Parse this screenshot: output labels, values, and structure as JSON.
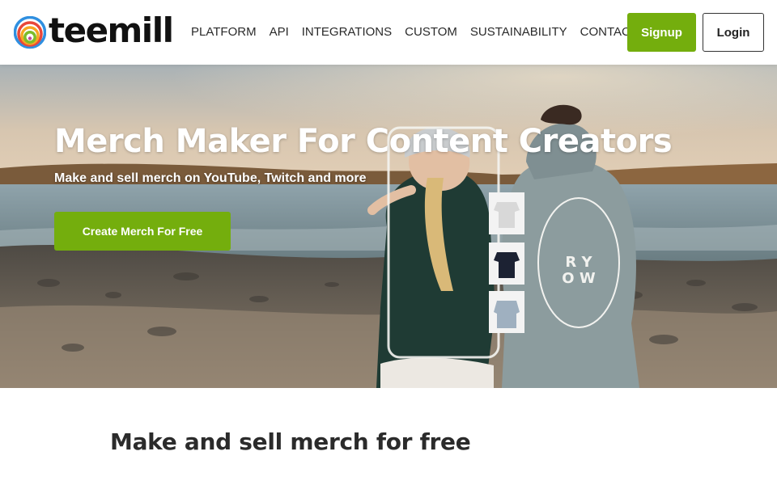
{
  "brand": {
    "name": "teemill",
    "accent": "#74ae0d"
  },
  "nav": {
    "items": [
      {
        "label": "PLATFORM"
      },
      {
        "label": "API"
      },
      {
        "label": "INTEGRATIONS"
      },
      {
        "label": "CUSTOM"
      },
      {
        "label": "SUSTAINABILITY"
      },
      {
        "label": "CONTACT"
      }
    ]
  },
  "header": {
    "signup_label": "Signup",
    "login_label": "Login"
  },
  "hero": {
    "title": "Merch Maker For Content Creators",
    "subtitle": "Make and sell merch on YouTube, Twitch and more",
    "cta_label": "Create Merch For Free"
  },
  "section": {
    "title": "Make and sell merch for free"
  }
}
